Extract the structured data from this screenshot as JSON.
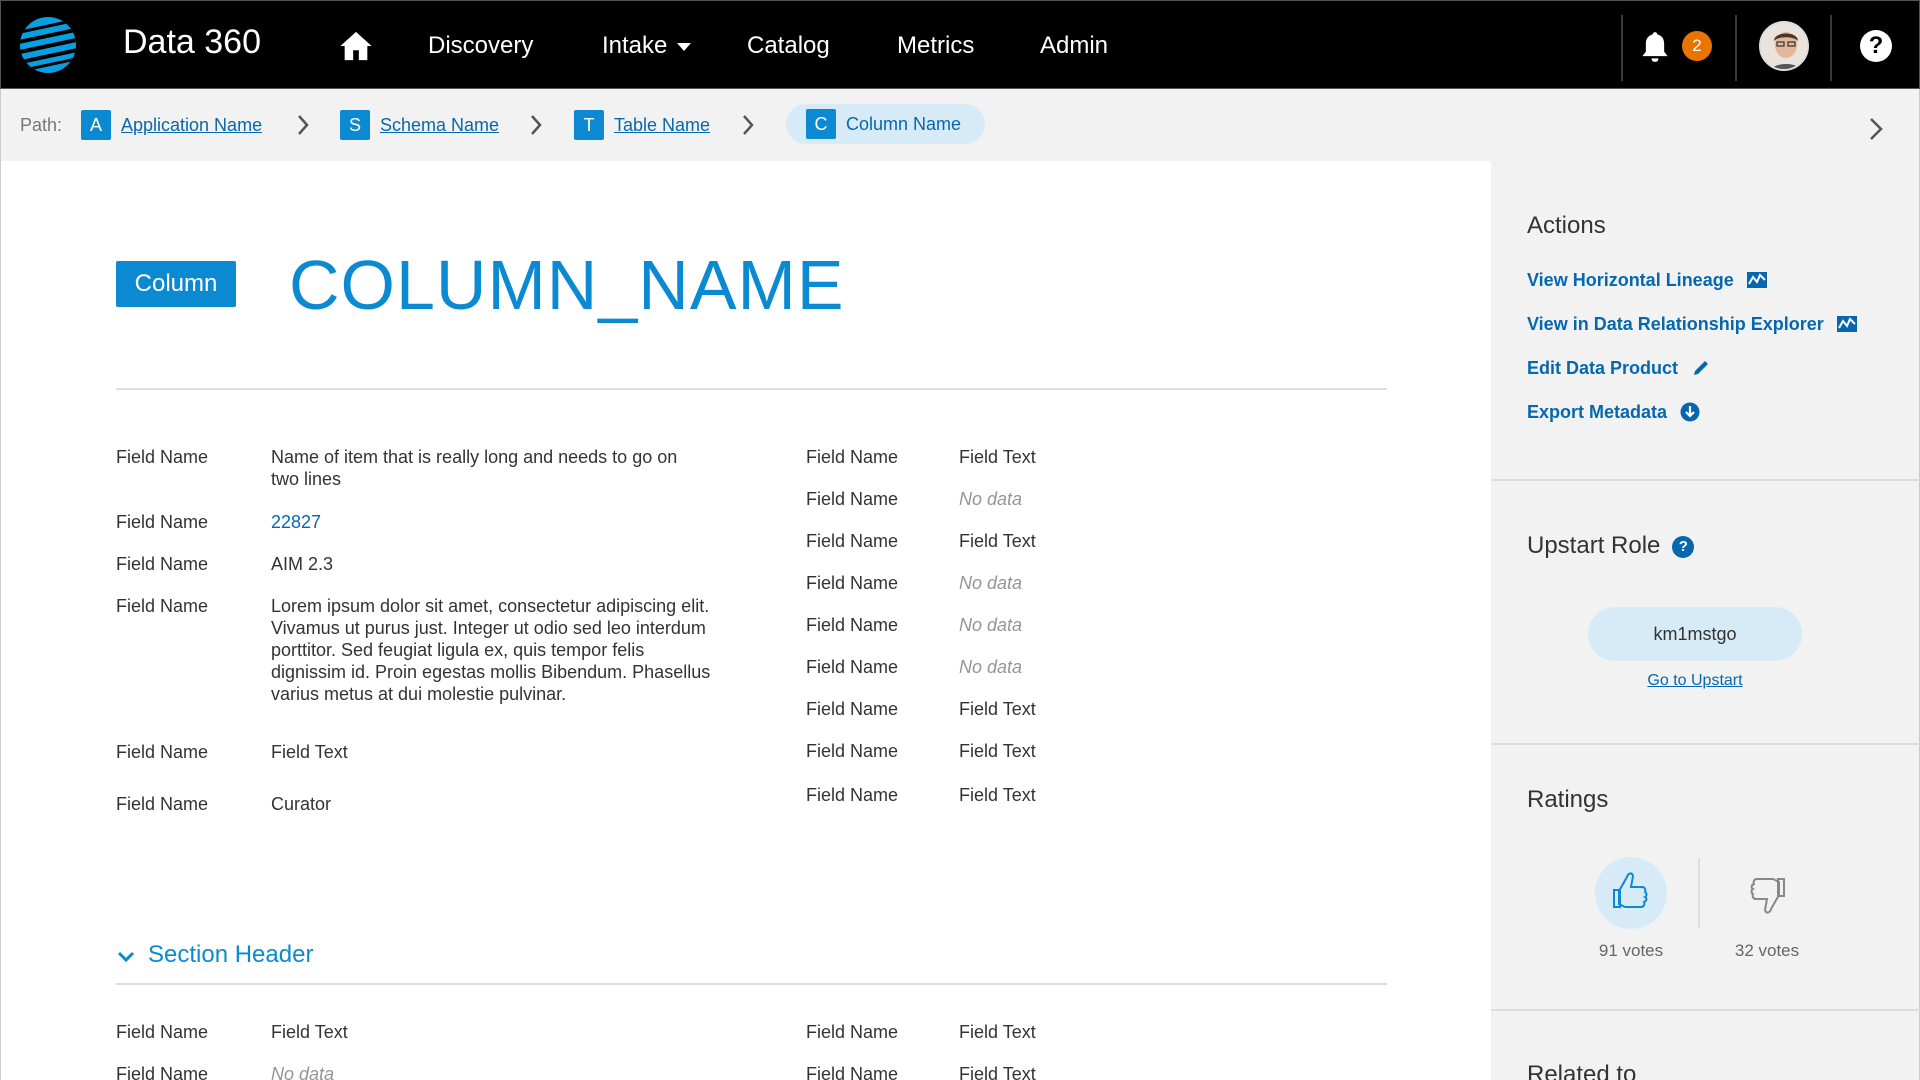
{
  "header": {
    "app_title": "Data 360",
    "nav": [
      {
        "label": "Discovery"
      },
      {
        "label": "Intake"
      },
      {
        "label": "Catalog"
      },
      {
        "label": "Metrics"
      },
      {
        "label": "Admin"
      }
    ],
    "notification_count": "2",
    "help_label": "?"
  },
  "breadcrumb": {
    "path_label": "Path:",
    "items": [
      {
        "badge": "A",
        "label": "Application Name"
      },
      {
        "badge": "S",
        "label": "Schema Name"
      },
      {
        "badge": "T",
        "label": "Table Name"
      },
      {
        "badge": "C",
        "label": "Column Name"
      }
    ]
  },
  "main": {
    "type_badge": "Column",
    "title": "COLUMN_NAME",
    "left_fields": [
      {
        "label": "Field Name",
        "value": "Name of item that is really long and needs to go on two lines"
      },
      {
        "label": "Field Name",
        "value": "22827"
      },
      {
        "label": "Field Name",
        "value": "AIM 2.3"
      },
      {
        "label": "Field Name",
        "value": "Lorem ipsum dolor sit amet, consectetur adipiscing elit. Vivamus ut purus just. Integer ut odio sed leo interdum porttitor. Sed feugiat ligula ex, quis tempor felis dignissim id. Proin egestas mollis Bibendum. Phasellus varius metus at dui molestie pulvinar."
      },
      {
        "label": "Field Name",
        "value": "Field Text"
      },
      {
        "label": "Field Name",
        "value": "Curator"
      }
    ],
    "right_fields": [
      {
        "label": "Field Name",
        "value": "Field Text"
      },
      {
        "label": "Field Name",
        "value": "No data"
      },
      {
        "label": "Field Name",
        "value": "Field Text"
      },
      {
        "label": "Field Name",
        "value": "No data"
      },
      {
        "label": "Field Name",
        "value": "No data"
      },
      {
        "label": "Field Name",
        "value": "No data"
      },
      {
        "label": "Field Name",
        "value": "Field Text"
      },
      {
        "label": "Field Name",
        "value": "Field Text"
      },
      {
        "label": "Field Name",
        "value": "Field Text"
      }
    ],
    "section_header": "Section Header",
    "section_fields": [
      {
        "label": "Field Name",
        "value": "Field Text"
      },
      {
        "label": "Field Name",
        "value": "No data"
      },
      {
        "label": "Field Name",
        "value": "Field Text"
      },
      {
        "label": "Field Name",
        "value": "Field Text"
      }
    ]
  },
  "sidebar": {
    "actions_title": "Actions",
    "actions": [
      {
        "label": "View Horizontal Lineage",
        "icon": "chart-icon"
      },
      {
        "label": "View in Data Relationship Explorer",
        "icon": "chart-icon"
      },
      {
        "label": "Edit Data Product",
        "icon": "pencil-icon"
      },
      {
        "label": "Export Metadata",
        "icon": "download-icon"
      }
    ],
    "role_title": "Upstart Role",
    "role_value": "km1mstgo",
    "role_link": "Go to Upstart",
    "ratings_title": "Ratings",
    "up_votes": "91 votes",
    "down_votes": "32 votes",
    "related_title": "Related to"
  },
  "colors": {
    "accent": "#0c8ad1",
    "link": "#0568ae",
    "badge_orange": "#ea7400"
  }
}
